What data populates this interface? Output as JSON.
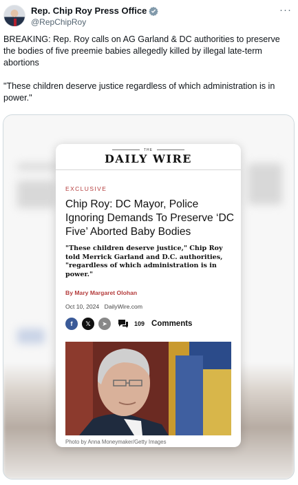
{
  "post": {
    "display_name": "Rep. Chip Roy Press Office",
    "handle": "@RepChipRoy",
    "more_label": "···",
    "text_1": "BREAKING: Rep. Roy calls on AG Garland & DC authorities to preserve the bodies of five preemie babies allegedly killed by illegal late-term abortions",
    "text_2": "\"These children deserve justice regardless of which administration is in power.\""
  },
  "article": {
    "masthead_the": "THE",
    "masthead_name": "DAILY WIRE",
    "kicker": "EXCLUSIVE",
    "headline": "Chip Roy: DC Mayor, Police Ignoring Demands To Preserve ‘DC Five’ Aborted Baby Bodies",
    "dek": "\"These children deserve justice,\" Chip Roy told Merrick Garland and D.C. authorities, \"regardless of which administration is in power.\"",
    "byline_prefix": "By",
    "byline_author": "Mary Margaret Olohan",
    "date": "Oct 10, 2024",
    "site": "DailyWire.com",
    "share": {
      "facebook": "f",
      "x": "𝕏",
      "telegram": "➤"
    },
    "comment_count": "109",
    "comment_label": "Comments",
    "photo_caption": "Photo by Anna Moneymaker/Getty Images"
  },
  "colors": {
    "accent_red": "#b43c3c",
    "verified_blue": "#1d9bf0",
    "facebook_blue": "#3a5a98"
  }
}
